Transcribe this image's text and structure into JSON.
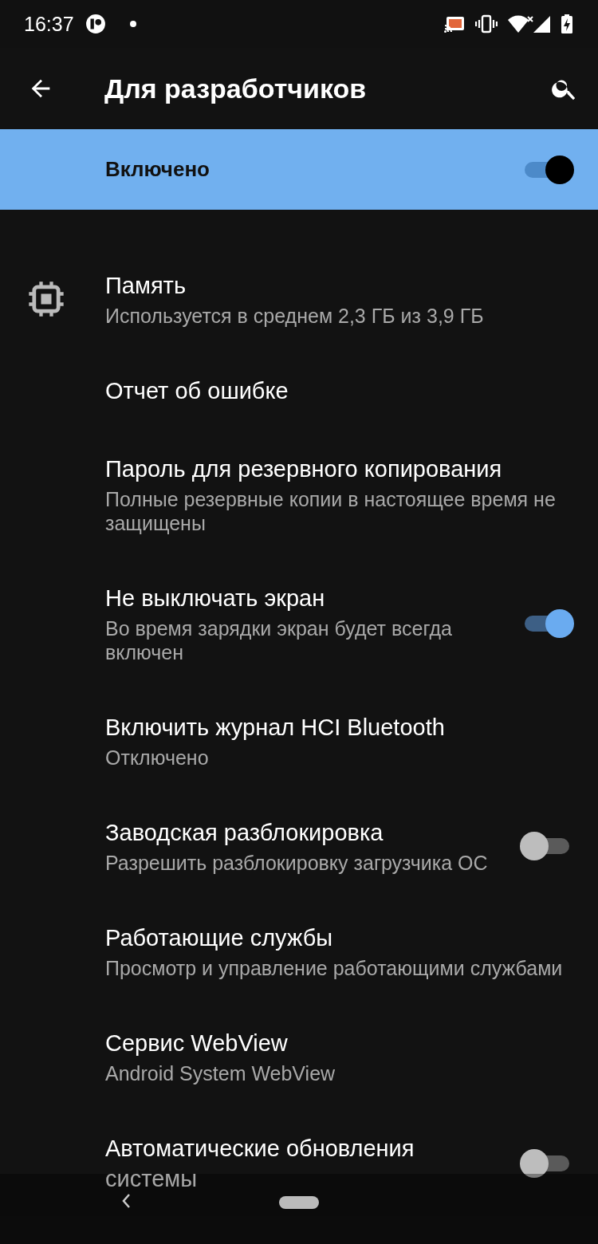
{
  "status_bar": {
    "time": "16:37"
  },
  "app_bar": {
    "title": "Для разработчиков"
  },
  "master_switch": {
    "label": "Включено",
    "on": true
  },
  "settings": [
    {
      "kind": "plain",
      "icon": true,
      "title": "Память",
      "summary": "Используется в среднем 2,3 ГБ из 3,9 ГБ"
    },
    {
      "kind": "plain",
      "title": "Отчет об ошибке"
    },
    {
      "kind": "plain",
      "title": "Пароль для резервного копирования",
      "summary": "Полные резервные копии в настоящее время не защищены"
    },
    {
      "kind": "switch",
      "on": true,
      "title": "Не выключать экран",
      "summary": "Во время зарядки экран будет всегда включен"
    },
    {
      "kind": "plain",
      "title": "Включить журнал HCI Bluetooth",
      "summary": "Отключено"
    },
    {
      "kind": "switch",
      "on": false,
      "title": "Заводская разблокировка",
      "summary": "Разрешить разблокировку загрузчика ОС"
    },
    {
      "kind": "plain",
      "title": "Работающие службы",
      "summary": "Просмотр и управление работающими службами"
    },
    {
      "kind": "plain",
      "title": "Сервис WebView",
      "summary": "Android System WebView"
    },
    {
      "kind": "switch",
      "on": false,
      "title": "Автоматические обновления системы"
    }
  ]
}
